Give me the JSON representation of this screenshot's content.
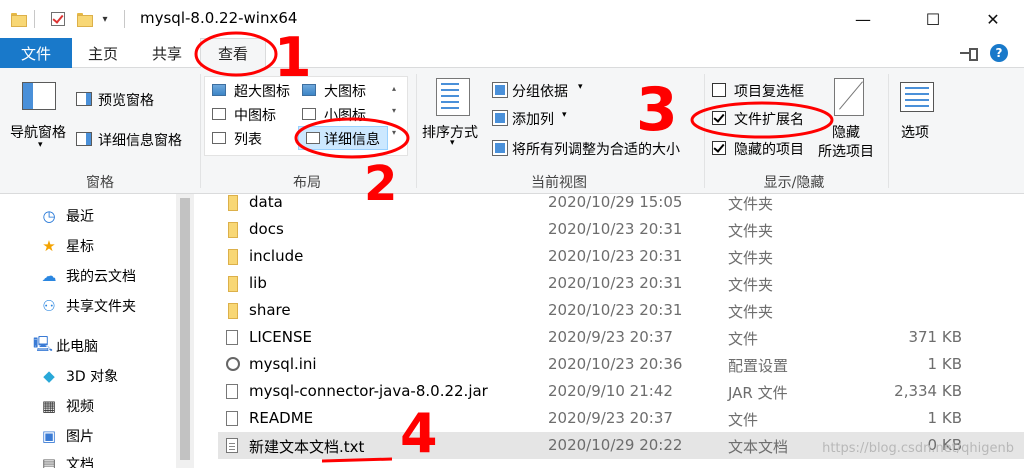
{
  "window": {
    "title": "mysql-8.0.22-winx64",
    "minimize_glyph": "—",
    "maximize_glyph": "☐",
    "close_glyph": "✕"
  },
  "quick_access": {
    "dropdown_glyph": "▾"
  },
  "tabs": [
    {
      "label": "文件"
    },
    {
      "label": "主页"
    },
    {
      "label": "共享"
    },
    {
      "label": "查看",
      "active": true
    }
  ],
  "tab_right": {
    "help_glyph": "?"
  },
  "ribbon": {
    "panes": {
      "navigation_pane": "导航窗格",
      "preview_pane": "预览窗格",
      "details_pane": "详细信息窗格",
      "group_label": "窗格"
    },
    "layout": {
      "items": [
        "超大图标",
        "大图标",
        "中图标",
        "小图标",
        "列表",
        "详细信息"
      ],
      "selected": "详细信息",
      "group_label": "布局"
    },
    "current_view": {
      "sort_by": "排序方式",
      "group_by": "分组依据",
      "add_columns": "添加列",
      "fit_columns": "将所有列调整为合适的大小",
      "group_label": "当前视图"
    },
    "show_hide": {
      "item_checkboxes": {
        "label": "项目复选框",
        "checked": false
      },
      "file_extensions": {
        "label": "文件扩展名",
        "checked": true
      },
      "hidden_items": {
        "label": "隐藏的项目",
        "checked": true
      },
      "hide_selected_line1": "隐藏",
      "hide_selected_line2": "所选项目",
      "group_label": "显示/隐藏"
    },
    "options": {
      "label": "选项"
    }
  },
  "nav_pane": {
    "items": [
      {
        "label": "最近",
        "icon": "clock-icon"
      },
      {
        "label": "星标",
        "icon": "star-icon"
      },
      {
        "label": "我的云文档",
        "icon": "cloud-icon"
      },
      {
        "label": "共享文件夹",
        "icon": "shared-folder-icon"
      },
      {
        "label": "此电脑",
        "icon": "computer-icon"
      },
      {
        "label": "3D 对象",
        "icon": "cube-icon"
      },
      {
        "label": "视频",
        "icon": "video-icon"
      },
      {
        "label": "图片",
        "icon": "picture-icon"
      },
      {
        "label": "文档",
        "icon": "document-icon"
      }
    ]
  },
  "files": [
    {
      "name": "data",
      "date": "2020/10/29 15:05",
      "type": "文件夹",
      "size": "",
      "icon": "folder"
    },
    {
      "name": "docs",
      "date": "2020/10/23 20:31",
      "type": "文件夹",
      "size": "",
      "icon": "folder"
    },
    {
      "name": "include",
      "date": "2020/10/23 20:31",
      "type": "文件夹",
      "size": "",
      "icon": "folder"
    },
    {
      "name": "lib",
      "date": "2020/10/23 20:31",
      "type": "文件夹",
      "size": "",
      "icon": "folder"
    },
    {
      "name": "share",
      "date": "2020/10/23 20:31",
      "type": "文件夹",
      "size": "",
      "icon": "folder"
    },
    {
      "name": "LICENSE",
      "date": "2020/9/23 20:37",
      "type": "文件",
      "size": "371 KB",
      "icon": "file"
    },
    {
      "name": "mysql.ini",
      "date": "2020/10/23 20:36",
      "type": "配置设置",
      "size": "1 KB",
      "icon": "settings"
    },
    {
      "name": "mysql-connector-java-8.0.22.jar",
      "date": "2020/9/10 21:42",
      "type": "JAR 文件",
      "size": "2,334 KB",
      "icon": "jar"
    },
    {
      "name": "README",
      "date": "2020/9/23 20:37",
      "type": "文件",
      "size": "1 KB",
      "icon": "file"
    },
    {
      "name": "新建文本文档.txt",
      "date": "2020/10/29 20:22",
      "type": "文本文档",
      "size": "0 KB",
      "icon": "text",
      "selected": true
    }
  ],
  "watermark": "https://blog.csdn.net/qhigenb",
  "annotations": [
    "1",
    "2",
    "3",
    "4"
  ],
  "colors": {
    "file_tab": "#1979ca",
    "selection": "#cce8ff",
    "annotation": "#ff0000"
  }
}
